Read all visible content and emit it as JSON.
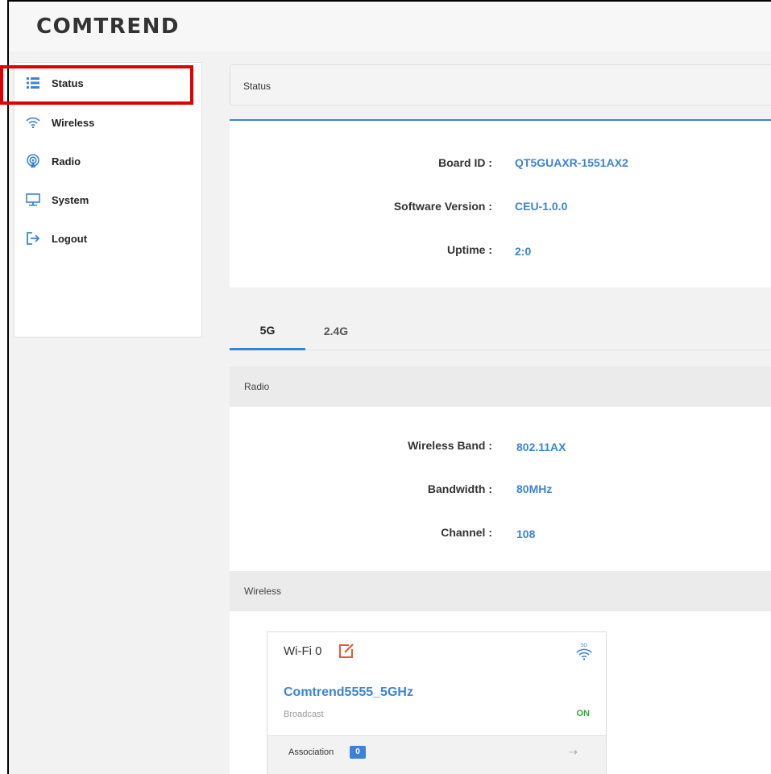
{
  "app": {
    "logo_text": "COMTREND"
  },
  "colors": {
    "accent": "#3c83d8",
    "highlight_box": "#e00000",
    "on_status": "#35a835",
    "edit_icon": "#e8582e"
  },
  "sidebar": {
    "items": [
      {
        "label": "Status",
        "icon": "list-icon",
        "active": true
      },
      {
        "label": "Wireless",
        "icon": "wifi-icon"
      },
      {
        "label": "Radio",
        "icon": "radio-antenna-icon"
      },
      {
        "label": "System",
        "icon": "monitor-icon"
      },
      {
        "label": "Logout",
        "icon": "logout-icon"
      }
    ]
  },
  "breadcrumb": {
    "title": "Status"
  },
  "device_info": {
    "board_id_label": "Board ID :",
    "board_id": "QT5GUAXR-1551AX2",
    "software_version_label": "Software Version :",
    "software_version": "CEU-1.0.0",
    "uptime_label": "Uptime :",
    "uptime": "2:0"
  },
  "tabs": [
    {
      "label": "5G",
      "active": true
    },
    {
      "label": "2.4G",
      "active": false
    }
  ],
  "radio_section": {
    "title": "Radio",
    "wireless_band_label": "Wireless Band :",
    "wireless_band": "802.11AX",
    "bandwidth_label": "Bandwidth :",
    "bandwidth": "80MHz",
    "channel_label": "Channel :",
    "channel": "108"
  },
  "wireless_section": {
    "title": "Wireless",
    "card": {
      "title": "Wi-Fi 0",
      "band_badge": "5G",
      "ssid": "Comtrend5555_5GHz",
      "broadcast_label": "Broadcast",
      "broadcast_value": "ON",
      "association_label": "Association",
      "association_count": "0",
      "arrow_glyph": "⇢"
    }
  }
}
